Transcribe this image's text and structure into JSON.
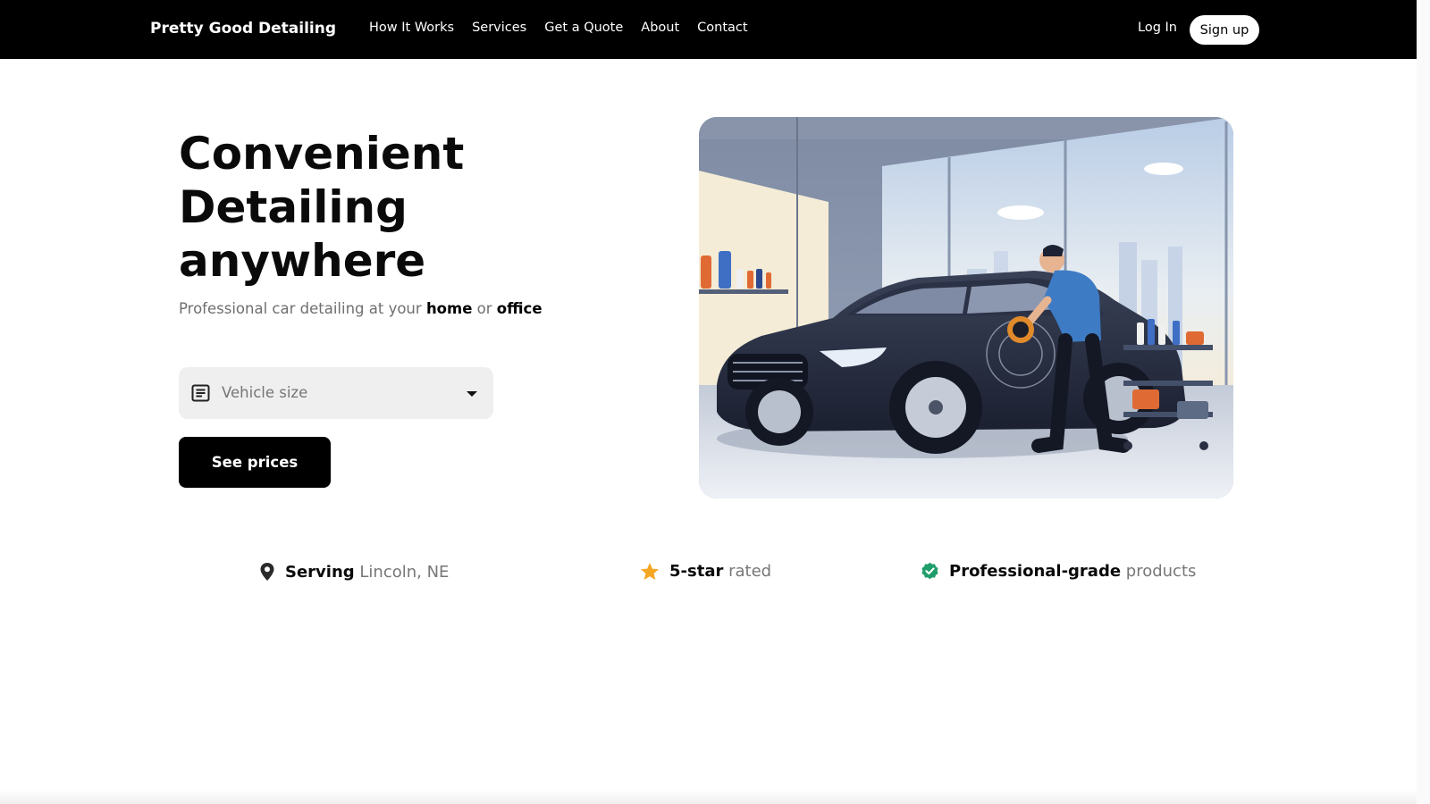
{
  "navbar": {
    "brand": "Pretty Good Detailing",
    "links": [
      "How It Works",
      "Services",
      "Get a Quote",
      "About",
      "Contact"
    ],
    "login": "Log In",
    "signup": "Sign up"
  },
  "hero": {
    "title_lines": [
      "Convenient",
      "Detailing",
      "anywhere"
    ],
    "subtitle_prefix": "Professional car detailing at your",
    "subtitle_home": "home",
    "subtitle_or": "or",
    "subtitle_office": "office",
    "vehicle_select": {
      "placeholder": "Vehicle size"
    },
    "cta": "See prices"
  },
  "features": [
    {
      "bold": "Serving",
      "light": "Lincoln, NE",
      "icon": "location-pin-icon"
    },
    {
      "bold": "5-star",
      "light": "rated",
      "icon": "star-icon"
    },
    {
      "bold": "Professional-grade",
      "light": "products",
      "icon": "check-badge-icon"
    }
  ],
  "colors": {
    "navbar_bg": "#000000",
    "star": "#f5a623",
    "check": "#1f9d6b",
    "cta_bg": "#000000",
    "select_bg": "#efefef"
  }
}
